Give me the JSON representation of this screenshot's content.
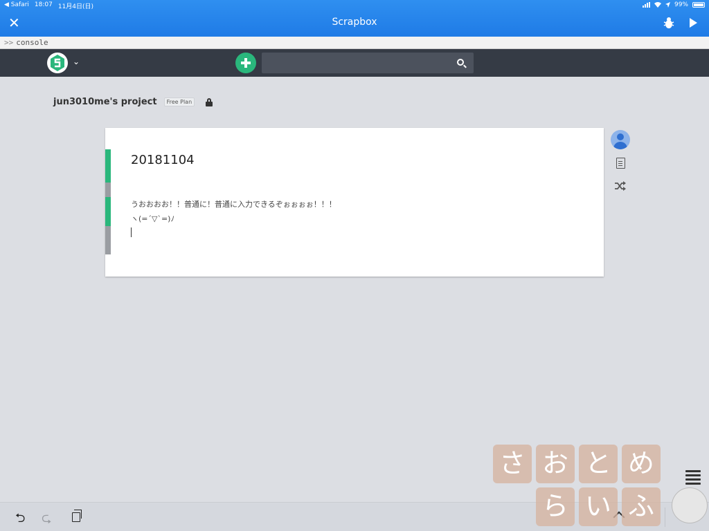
{
  "status_bar": {
    "app": "◀ Safari",
    "time": "18:07",
    "date": "11月4日(日)",
    "battery": "99%"
  },
  "nav": {
    "title": "Scrapbox"
  },
  "console": {
    "prompt": ">>",
    "text": "console"
  },
  "search": {
    "placeholder": ""
  },
  "project": {
    "name": "jun3010me's project",
    "plan": "Free Plan"
  },
  "page": {
    "title": "20181104",
    "lines": [
      "うおおおお！！普通に！普通に入力できるぞぉぉぉぉ！！！",
      "ヽ(=´▽`=)ﾉ"
    ]
  },
  "watermark": {
    "chars": [
      "さ",
      "お",
      "と",
      "め",
      "ら",
      "い",
      "ふ"
    ]
  },
  "colors": {
    "accent": "#2ab77c",
    "navbar": "#353b45",
    "ios_blue": "#1f7be6"
  }
}
